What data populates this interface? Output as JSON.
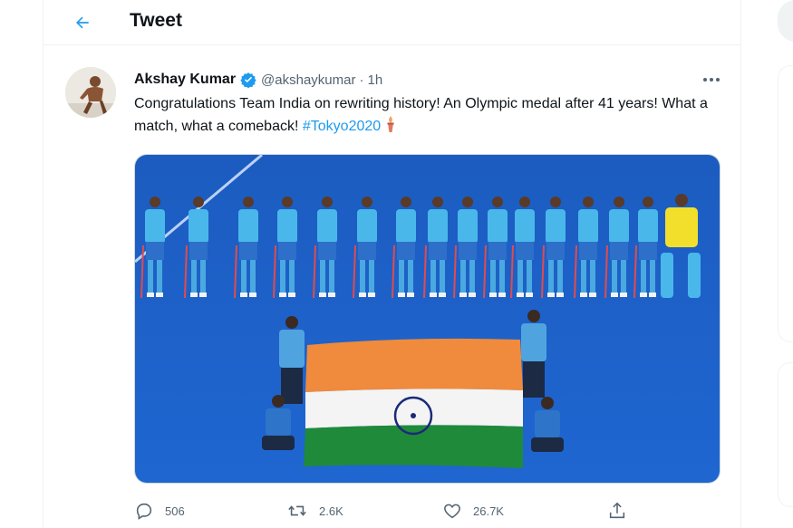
{
  "header": {
    "title": "Tweet",
    "back_icon": "arrow-left-icon"
  },
  "tweet": {
    "author_name": "Akshay Kumar",
    "verified": true,
    "handle": "@akshaykumar",
    "separator": "·",
    "time": "1h",
    "more_icon": "ellipsis-icon",
    "text_before_hashtag": "Congratulations Team India on rewriting history! An Olympic medal after 41 years! What a match, what a comeback!",
    "hashtag": "#Tokyo2020",
    "emoji": "torch-icon",
    "media_description_icon": "photo-icon"
  },
  "actions": {
    "reply_count": "506",
    "retweet_count": "2.6K",
    "like_count": "26.7K"
  },
  "colors": {
    "accent": "#1d9bf0",
    "verified": "#1d9bf0",
    "text": "#0f1419",
    "secondary": "#536471",
    "turf": "#1f63c7"
  }
}
